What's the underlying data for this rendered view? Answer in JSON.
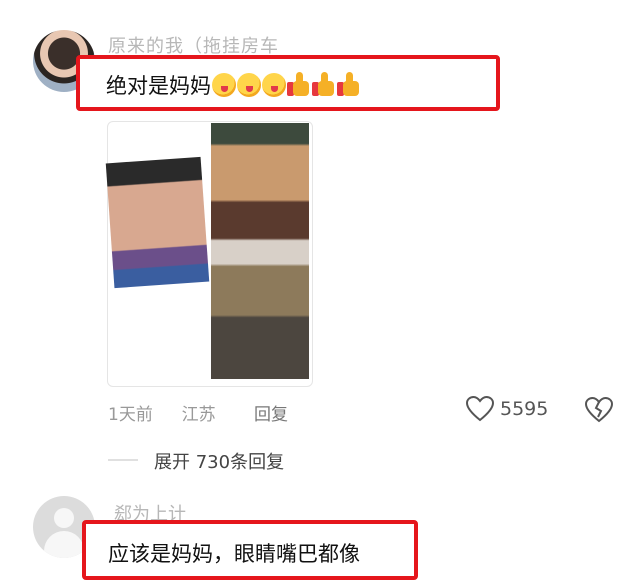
{
  "comment1": {
    "username": "原来的我（拖挂房车",
    "text": "绝对是妈妈",
    "emojis": [
      "grin-tongue-face",
      "grin-tongue-face",
      "grin-tongue-face",
      "thumbs-up",
      "thumbs-up",
      "thumbs-up"
    ],
    "time": "1天前",
    "location": "江苏",
    "reply_label": "回复",
    "like_count": "5595",
    "expand_replies": "展开 730条回复"
  },
  "comment2": {
    "username": "郄为上计",
    "text": "应该是妈妈，眼睛嘴巴都像"
  },
  "colors": {
    "highlight_box": "#e5161c"
  }
}
